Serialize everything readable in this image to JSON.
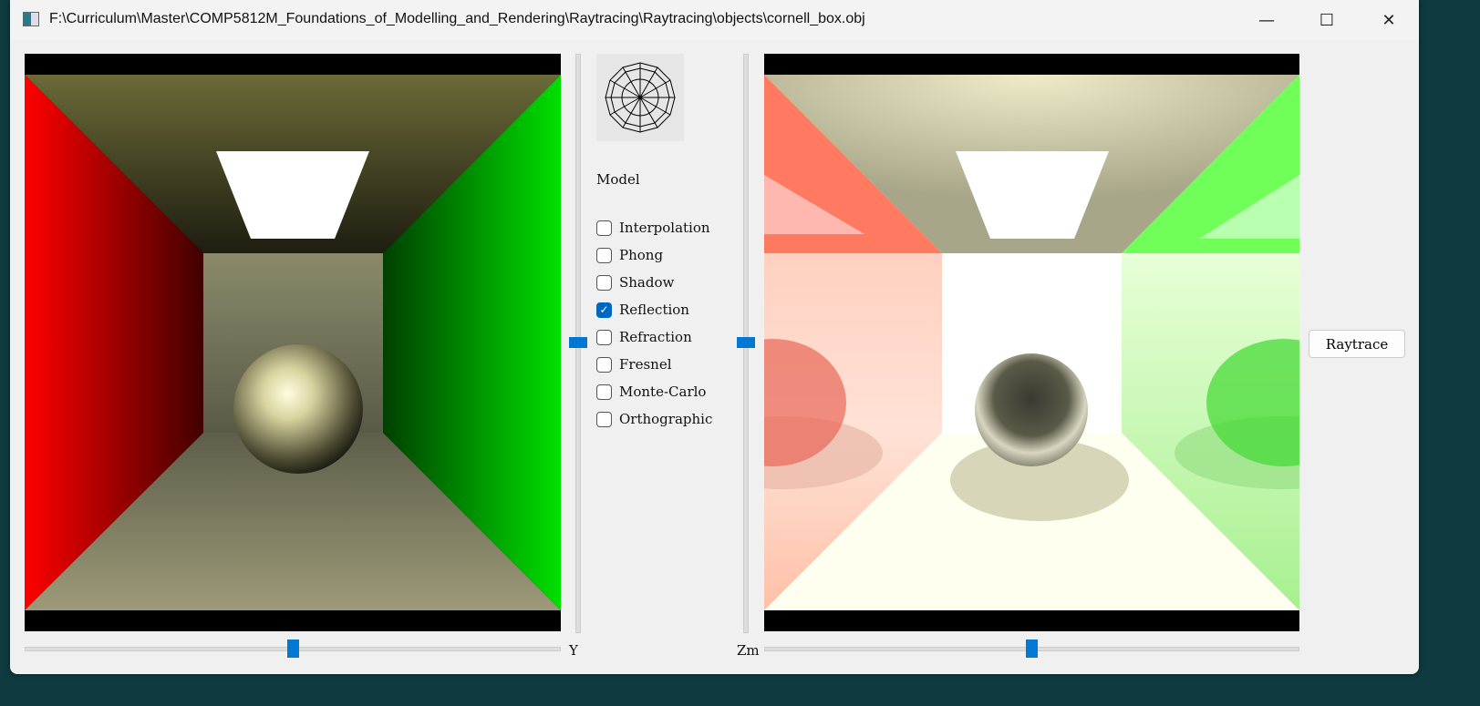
{
  "window": {
    "title": "F:\\Curriculum\\Master\\COMP5812M_Foundations_of_Modelling_and_Rendering\\Raytracing\\Raytracing\\objects\\cornell_box.obj",
    "minimize": "—",
    "maximize": "☐",
    "close": "✕"
  },
  "panel": {
    "model_label": "Model",
    "options": [
      {
        "label": "Interpolation",
        "checked": false
      },
      {
        "label": "Phong",
        "checked": false
      },
      {
        "label": "Shadow",
        "checked": false
      },
      {
        "label": "Reflection",
        "checked": true
      },
      {
        "label": "Refraction",
        "checked": false
      },
      {
        "label": "Fresnel",
        "checked": false
      },
      {
        "label": "Monte-Carlo",
        "checked": false
      },
      {
        "label": "Orthographic",
        "checked": false
      }
    ]
  },
  "sliders": {
    "y_label": "Y",
    "zoom_label": "Zm",
    "y_value": 0.5,
    "zoom_value": 0.5
  },
  "raytrace_button": "Raytrace",
  "colors": {
    "accent": "#0078d4"
  }
}
